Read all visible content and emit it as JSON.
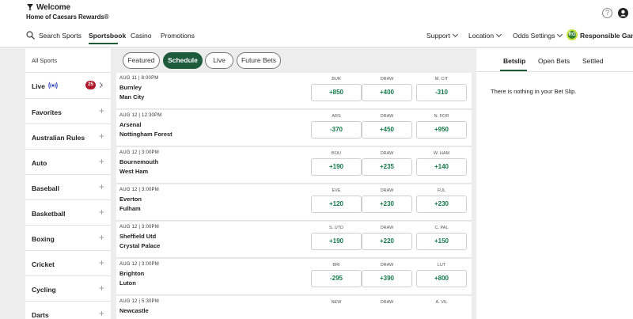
{
  "header": {
    "welcome": "Welcome",
    "subtitle": "Home of Caesars Rewards®",
    "help_glyph": "?"
  },
  "nav": {
    "search": "Search Sports",
    "sportsbook": "Sportsbook",
    "casino": "Casino",
    "promotions": "Promotions",
    "support": "Support",
    "location": "Location",
    "odds_settings": "Odds Settings",
    "responsible_gaming": "Responsible Gaming",
    "rg_badge": "RG"
  },
  "sidebar": {
    "title": "All Sports",
    "live_label": "Live",
    "live_count": "25",
    "items": [
      {
        "label": "Favorites"
      },
      {
        "label": "Australian Rules"
      },
      {
        "label": "Auto"
      },
      {
        "label": "Baseball"
      },
      {
        "label": "Basketball"
      },
      {
        "label": "Boxing"
      },
      {
        "label": "Cricket"
      },
      {
        "label": "Cycling"
      },
      {
        "label": "Darts"
      }
    ]
  },
  "filters": [
    "Featured",
    "Schedule",
    "Live",
    "Future Bets"
  ],
  "matches": [
    {
      "time": "AUG 11 | 8:00PM",
      "home": "Burnley",
      "away": "Man City",
      "h1": "BUR",
      "h2": "DRAW",
      "h3": "M. CIT",
      "o1": "+850",
      "o2": "+400",
      "o3": "-310"
    },
    {
      "time": "AUG 12 | 12:30PM",
      "home": "Arsenal",
      "away": "Nottingham Forest",
      "h1": "ARS",
      "h2": "DRAW",
      "h3": "N. FOR",
      "o1": "-370",
      "o2": "+450",
      "o3": "+950"
    },
    {
      "time": "AUG 12 | 3:00PM",
      "home": "Bournemouth",
      "away": "West Ham",
      "h1": "BOU",
      "h2": "DRAW",
      "h3": "W. HAM",
      "o1": "+190",
      "o2": "+235",
      "o3": "+140"
    },
    {
      "time": "AUG 12 | 3:00PM",
      "home": "Everton",
      "away": "Fulham",
      "h1": "EVE",
      "h2": "DRAW",
      "h3": "FUL",
      "o1": "+120",
      "o2": "+230",
      "o3": "+230"
    },
    {
      "time": "AUG 12 | 3:00PM",
      "home": "Sheffield Utd",
      "away": "Crystal Palace",
      "h1": "S. UTD",
      "h2": "DRAW",
      "h3": "C. PAL",
      "o1": "+190",
      "o2": "+220",
      "o3": "+150"
    },
    {
      "time": "AUG 12 | 3:00PM",
      "home": "Brighton",
      "away": "Luton",
      "h1": "BRI",
      "h2": "DRAW",
      "h3": "LUT",
      "o1": "-295",
      "o2": "+390",
      "o3": "+800"
    },
    {
      "time": "AUG 12 | 5:30PM",
      "home": "Newcastle",
      "away": "",
      "h1": "NEW",
      "h2": "DRAW",
      "h3": "A. VIL",
      "o1": "",
      "o2": "",
      "o3": ""
    }
  ],
  "betslip": {
    "tabs": [
      "Betslip",
      "Open Bets",
      "Settled"
    ],
    "empty_message": "There is nothing in your Bet Slip."
  },
  "colors": {
    "accent_green": "#1d5b3b",
    "odds_green": "#14794b",
    "live_badge": "#b0182c"
  }
}
